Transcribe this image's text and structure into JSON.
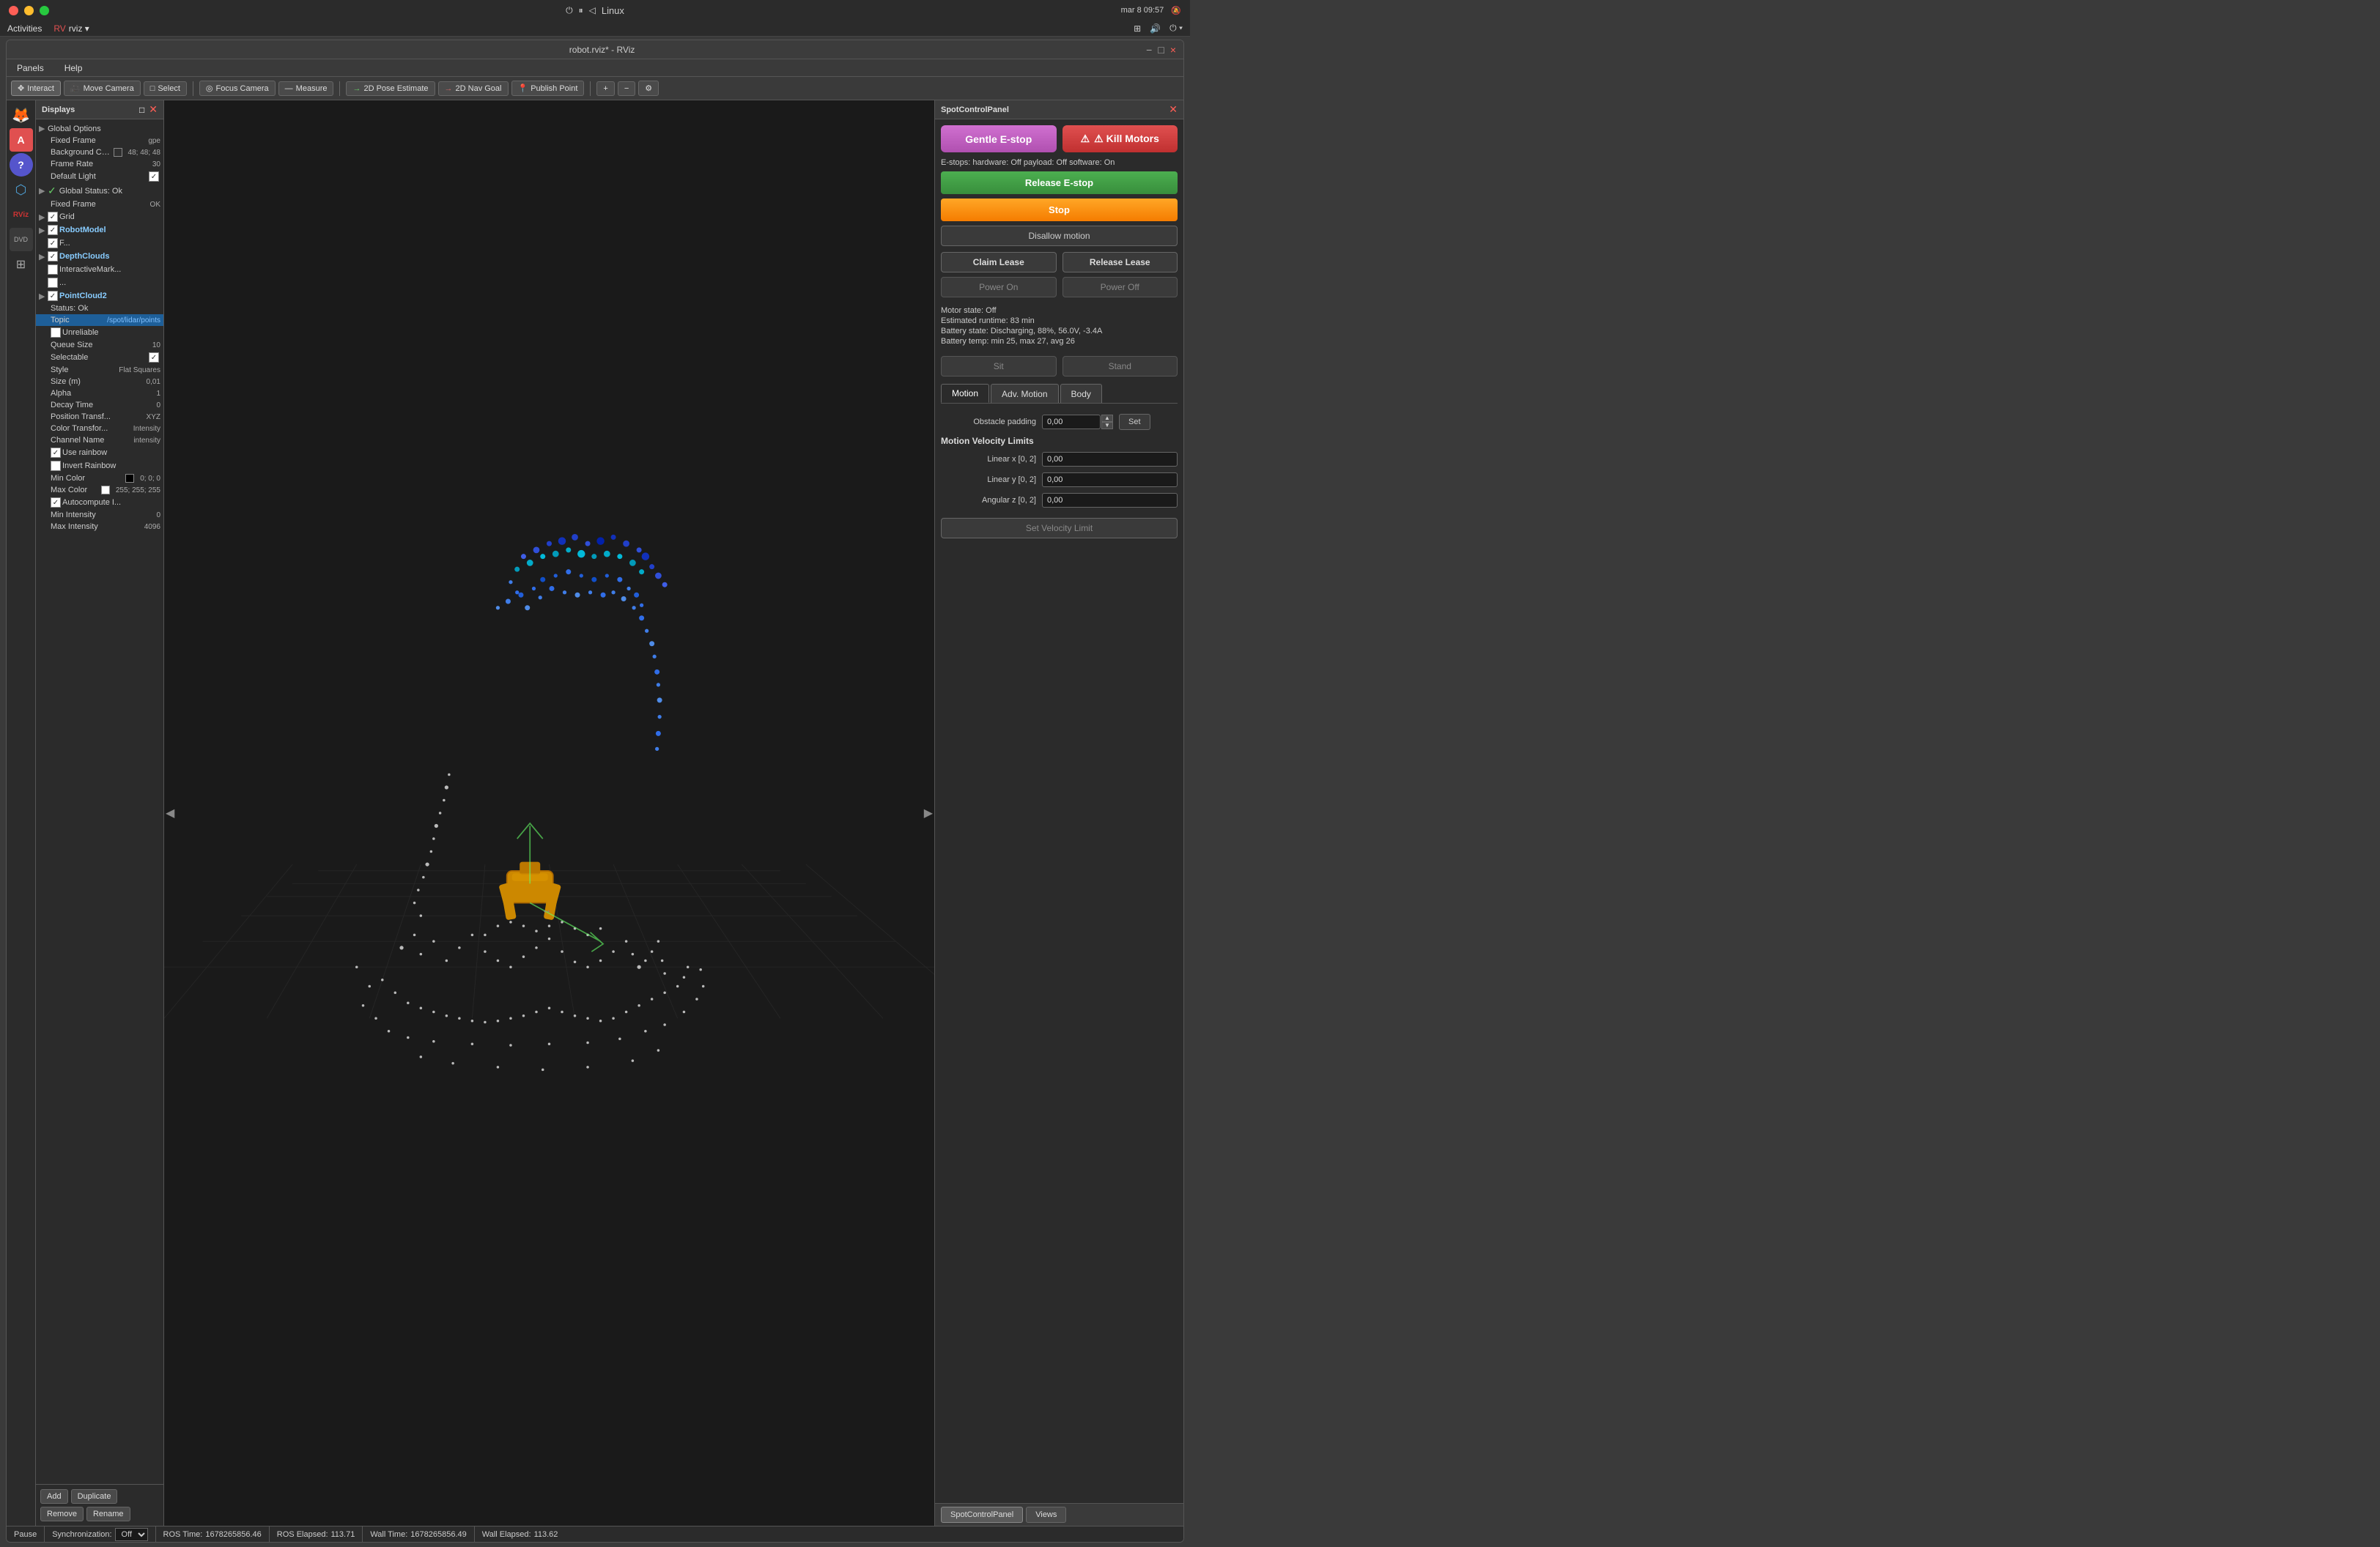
{
  "system": {
    "os": "Linux",
    "time": "mar 8  09:57",
    "wifi_icon": "wifi",
    "battery_icon": "battery"
  },
  "window": {
    "title": "robot.rviz* - RViz",
    "minimize": "−",
    "maximize": "□",
    "close": "×"
  },
  "menubar": {
    "panels": "Panels",
    "help": "Help"
  },
  "toolbar": {
    "interact": "Interact",
    "move_camera": "Move Camera",
    "select": "Select",
    "focus_camera": "Focus Camera",
    "measure": "Measure",
    "pose_estimate": "2D Pose Estimate",
    "nav_goal": "2D Nav Goal",
    "publish_point": "Publish Point"
  },
  "displays_panel": {
    "title": "Displays",
    "items": [
      {
        "label": "Global Options",
        "indent": 0,
        "has_arrow": true,
        "arrow": "▶",
        "checked": null
      },
      {
        "label": "Fixed Frame",
        "indent": 1,
        "value": "gpe",
        "checked": null
      },
      {
        "label": "Background Color",
        "indent": 1,
        "value": "48; 48; 48",
        "color": "#303030",
        "checked": null
      },
      {
        "label": "Frame Rate",
        "indent": 1,
        "value": "30",
        "checked": null
      },
      {
        "label": "Default Light",
        "indent": 1,
        "value": "",
        "checked": true
      },
      {
        "label": "Global Status: Ok",
        "indent": 0,
        "has_arrow": true,
        "arrow": "▶",
        "checked": null
      },
      {
        "label": "Fixed Frame",
        "indent": 1,
        "value": "OK",
        "checked": null
      },
      {
        "label": "Grid",
        "indent": 0,
        "has_arrow": true,
        "arrow": "▶",
        "checked": true
      },
      {
        "label": "RobotModel",
        "indent": 0,
        "has_arrow": true,
        "arrow": "▶",
        "checked": true,
        "bold": true
      },
      {
        "label": "F...",
        "indent": 0,
        "value": "",
        "checked": true
      },
      {
        "label": "DepthClouds",
        "indent": 0,
        "has_arrow": true,
        "arrow": "▶",
        "checked": true,
        "bold": true
      },
      {
        "label": "InteractiveMark...",
        "indent": 0,
        "value": "",
        "checked": false
      },
      {
        "label": "...",
        "indent": 0,
        "value": "",
        "checked": false
      },
      {
        "label": "PointCloud2",
        "indent": 0,
        "has_arrow": true,
        "arrow": "▶",
        "checked": true,
        "bold": true
      },
      {
        "label": "Status: Ok",
        "indent": 1,
        "value": "",
        "checked": null
      },
      {
        "label": "Topic",
        "indent": 1,
        "value": "/spot/lidar/points",
        "checked": null,
        "selected": true
      },
      {
        "label": "Unreliable",
        "indent": 1,
        "value": "",
        "checked": false
      },
      {
        "label": "Queue Size",
        "indent": 1,
        "value": "10",
        "checked": null
      },
      {
        "label": "Selectable",
        "indent": 1,
        "value": "",
        "checked": true
      },
      {
        "label": "Style",
        "indent": 1,
        "value": "Flat Squares",
        "checked": null
      },
      {
        "label": "Size (m)",
        "indent": 1,
        "value": "0,01",
        "checked": null
      },
      {
        "label": "Alpha",
        "indent": 1,
        "value": "1",
        "checked": null
      },
      {
        "label": "Decay Time",
        "indent": 1,
        "value": "0",
        "checked": null
      },
      {
        "label": "Position Transf...",
        "indent": 1,
        "value": "XYZ",
        "checked": null
      },
      {
        "label": "Color Transfor...",
        "indent": 1,
        "value": "Intensity",
        "checked": null
      },
      {
        "label": "Channel Name",
        "indent": 1,
        "value": "intensity",
        "checked": null
      },
      {
        "label": "Use rainbow",
        "indent": 1,
        "value": "",
        "checked": true
      },
      {
        "label": "Invert Rainbow",
        "indent": 1,
        "value": "",
        "checked": false
      },
      {
        "label": "Min Color",
        "indent": 1,
        "value": "0; 0; 0",
        "color": "#000000",
        "checked": null
      },
      {
        "label": "Max Color",
        "indent": 1,
        "value": "255; 255; 255",
        "color": "#ffffff",
        "checked": null
      },
      {
        "label": "Autocompute I...",
        "indent": 1,
        "value": "",
        "checked": true
      },
      {
        "label": "Min Intensity",
        "indent": 1,
        "value": "0",
        "checked": null
      },
      {
        "label": "Max Intensity",
        "indent": 1,
        "value": "4096",
        "checked": null
      }
    ],
    "buttons": {
      "add": "Add",
      "duplicate": "Duplicate",
      "remove": "Remove",
      "rename": "Rename"
    }
  },
  "spot_panel": {
    "title": "SpotControlPanel",
    "gentle_estop": "Gentle E-stop",
    "kill_motors": "⚠ Kill Motors",
    "estop_status": "E-stops: hardware: Off payload: Off software: On",
    "release_estop": "Release E-stop",
    "stop": "Stop",
    "disallow_motion": "Disallow motion",
    "claim_lease": "Claim Lease",
    "release_lease": "Release Lease",
    "power_on": "Power On",
    "power_off": "Power Off",
    "motor_state": "Motor state: Off",
    "estimated_runtime": "Estimated runtime: 83 min",
    "battery_state": "Battery state: Discharging, 88%, 56.0V, -3.4A",
    "battery_temp": "Battery temp: min 25, max 27, avg 26",
    "sit": "Sit",
    "stand": "Stand",
    "tabs": {
      "motion": "Motion",
      "adv_motion": "Adv. Motion",
      "body": "Body"
    },
    "motion": {
      "obstacle_padding_label": "Obstacle padding",
      "obstacle_padding_value": "0,00",
      "set_label": "Set",
      "velocity_limits_title": "Motion Velocity Limits",
      "linear_x_label": "Linear x [0, 2]",
      "linear_x_value": "0,00",
      "linear_y_label": "Linear y [0, 2]",
      "linear_y_value": "0,00",
      "angular_z_label": "Angular z [0, 2]",
      "angular_z_value": "0,00",
      "set_velocity_limit": "Set Velocity Limit"
    }
  },
  "bottom_tabs": {
    "spot_control": "SpotControlPanel",
    "views": "Views"
  },
  "status_bar": {
    "pause": "Pause",
    "synchronization_label": "Synchronization:",
    "synchronization_value": "Off",
    "ros_time_label": "ROS Time:",
    "ros_time_value": "1678265856.46",
    "ros_elapsed_label": "ROS Elapsed:",
    "ros_elapsed_value": "113.71",
    "wall_time_label": "Wall Time:",
    "wall_time_value": "1678265856.49",
    "wall_elapsed_label": "Wall Elapsed:",
    "wall_elapsed_value": "113.62"
  },
  "sidebar_icons": [
    {
      "name": "firefox",
      "icon": "🦊"
    },
    {
      "name": "terminal",
      "icon": "A"
    },
    {
      "name": "help",
      "icon": "?"
    },
    {
      "name": "vscode",
      "icon": "VS"
    },
    {
      "name": "rviz",
      "icon": "RViz"
    },
    {
      "name": "dvd",
      "icon": "DVD"
    },
    {
      "name": "grid",
      "icon": "⊞"
    }
  ]
}
